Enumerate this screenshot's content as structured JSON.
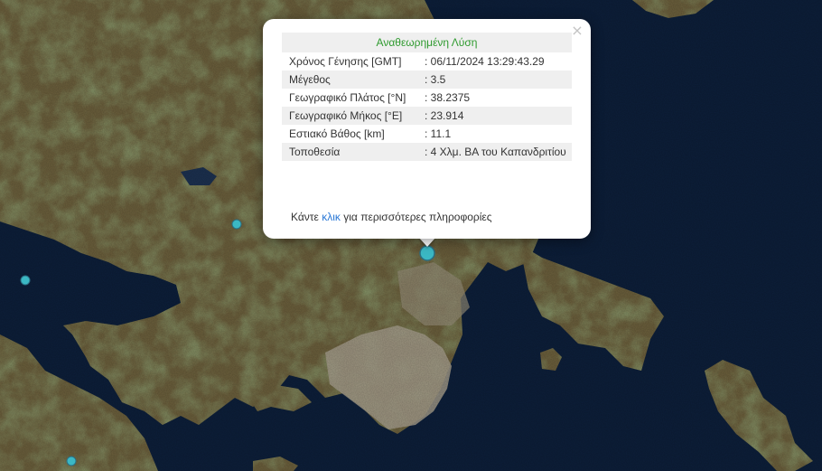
{
  "popup": {
    "close_label": "×",
    "title": "Αναθεωρημένη Λύση",
    "rows": [
      {
        "label": "Χρόνος Γένησης [GMT]",
        "value": ": 06/11/2024 13:29:43.29"
      },
      {
        "label": "Μέγεθος",
        "value": ": 3.5"
      },
      {
        "label": "Γεωγραφικό Πλάτος [°N]",
        "value": ": 38.2375"
      },
      {
        "label": "Γεωγραφικό Μήκος [°E]",
        "value": ": 23.914"
      },
      {
        "label": "Εστιακό Βάθος [km]",
        "value": ": 11.1"
      },
      {
        "label": "Τοποθεσία",
        "value": ": 4 Χλμ. ΒΑ του Καπανδριτίου"
      }
    ],
    "more_prefix": "Κάντε",
    "more_link": "κλικ",
    "more_suffix": "για περισσότερες πληροφορίες"
  },
  "colors": {
    "sea": "#0d1f3a",
    "land": "#6b5f3c",
    "forest": "#3f4f25",
    "urban": "#a49c8b",
    "marker": "#3bb8c4",
    "marker_stroke": "#2a6e82",
    "title_green": "#2e9a2e",
    "link_blue": "#2a78d6"
  }
}
